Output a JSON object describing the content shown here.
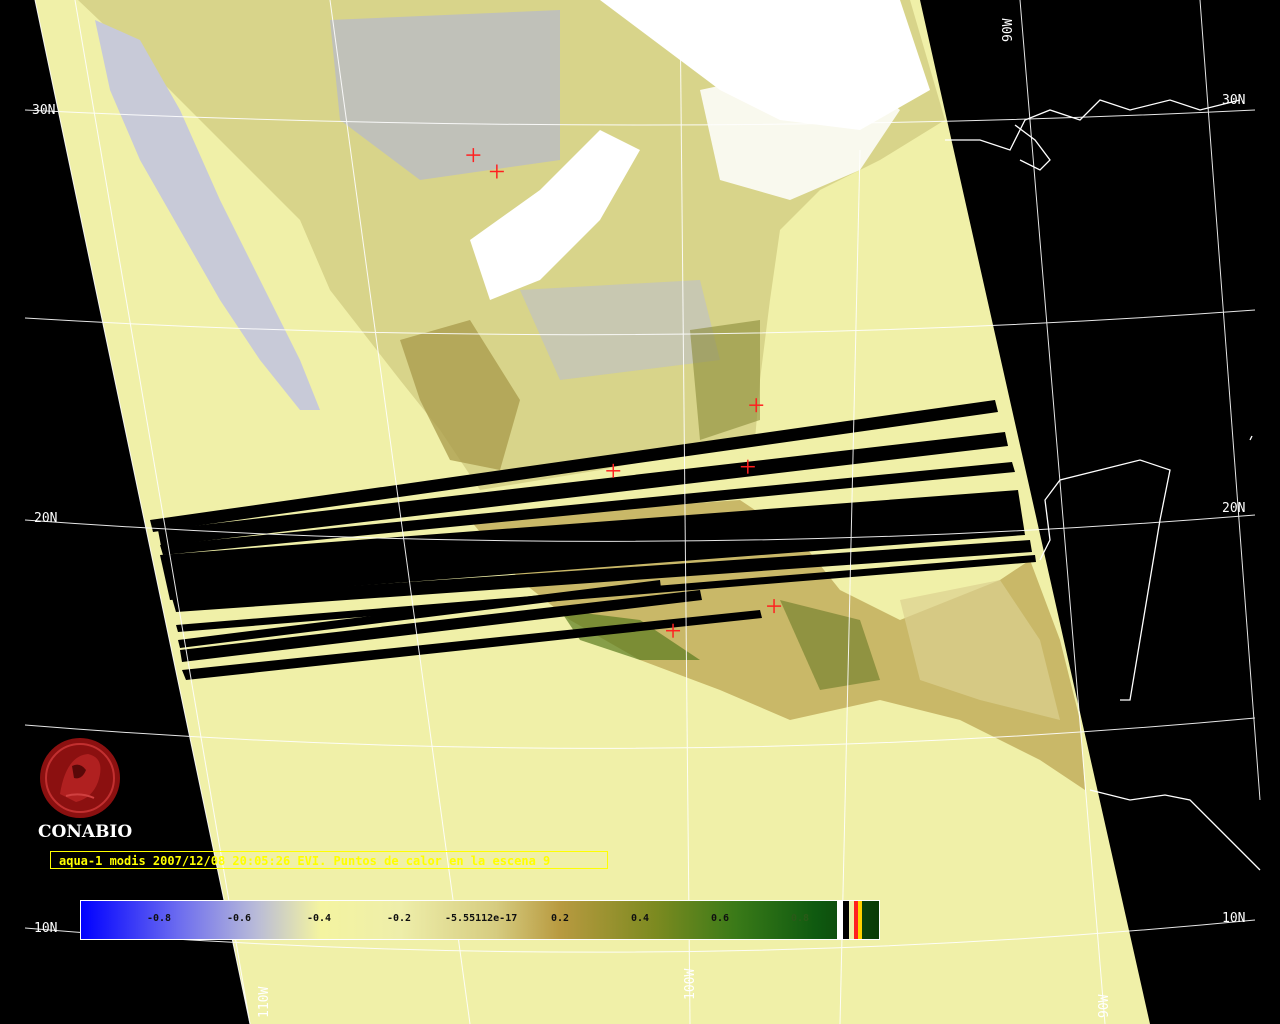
{
  "grid_labels": {
    "lat_30n_left": "30N",
    "lat_30n_right": "30N",
    "lat_20n_left": "20N",
    "lat_20n_right": "20N",
    "lat_10n_left": "10N",
    "lat_10n_right": "10N",
    "lon_110w": "110W",
    "lon_100w": "100W",
    "lon_90w_top": "90W",
    "lon_90w_bottom": "90W"
  },
  "logo": {
    "name": "CONABIO"
  },
  "caption": "aqua-1 modis 2007/12/08 20:05:26 EVI. Puntos de calor en la escena 9",
  "colorbar": {
    "ticks": [
      "-0.8",
      "-0.6",
      "-0.4",
      "-0.2",
      "-5.55112e-17",
      "0.2",
      "0.4",
      "0.6",
      "0.8"
    ]
  },
  "colors": {
    "background": "#000000",
    "ocean_swath": "#f0f0a8",
    "cloud": "#ffffff",
    "hotspot_marker": "#ff2020",
    "caption_text": "#ffff00",
    "logo": "#8b1010",
    "coastline": "#ffffff",
    "grid": "#ffffff"
  },
  "hotspots": [
    {
      "lat": 28.9,
      "lon": -106.3
    },
    {
      "lat": 28.5,
      "lon": -105.6
    },
    {
      "lat": 22.8,
      "lon": -97.9
    },
    {
      "lat": 21.2,
      "lon": -102.3
    },
    {
      "lat": 21.3,
      "lon": -98.2
    },
    {
      "lat": 17.3,
      "lon": -100.6
    },
    {
      "lat": 17.9,
      "lon": -97.5
    }
  ]
}
